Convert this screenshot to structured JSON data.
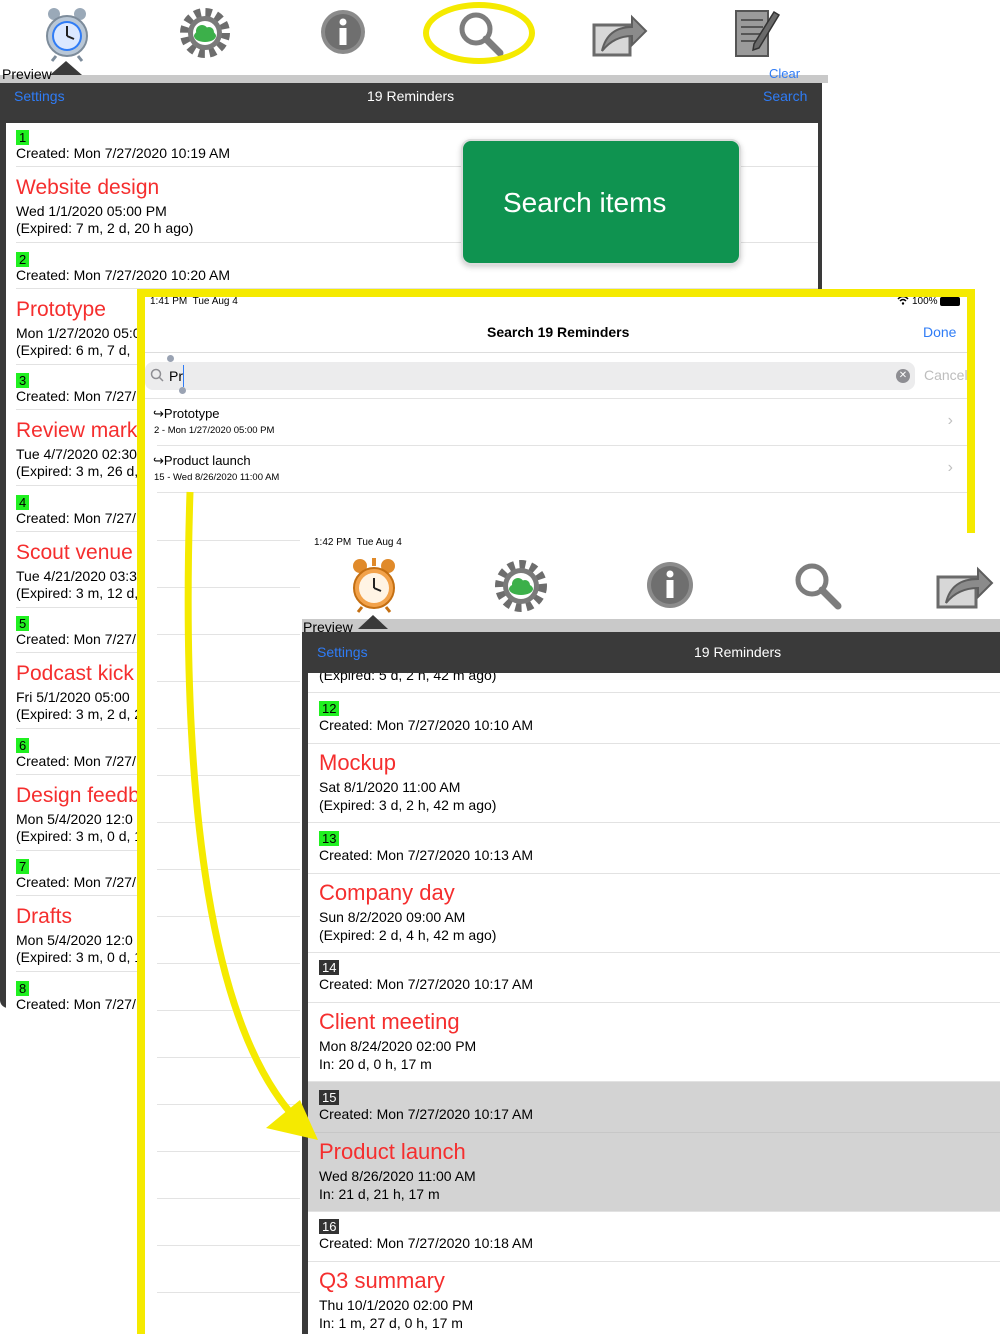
{
  "colors": {
    "accent": "#2f7cf6",
    "title_red": "#f52e2e",
    "badge_green": "#20f020",
    "callout_green": "#0f9350",
    "highlight_yellow": "#f5ea00",
    "navbar_dark": "#3a3a3a"
  },
  "top_icons": [
    "alarm-clock-icon",
    "cloud-gear-icon",
    "info-icon",
    "magnifier-icon",
    "share-export-icon",
    "notepad-icon"
  ],
  "panel1": {
    "tab_label": "Preview",
    "clear_label": "Clear",
    "nav": {
      "settings": "Settings",
      "title": "19 Reminders",
      "search": "Search"
    },
    "items": [
      {
        "num": "1",
        "created": "Created: Mon 7/27/2020 10:19 AM",
        "title": "Website design",
        "date": "Wed 1/1/2020 05:00 PM",
        "status": "(Expired: 7 m, 2 d, 20 h ago)"
      },
      {
        "num": "2",
        "created": "Created: Mon 7/27/2020 10:20 AM",
        "title": "Prototype",
        "date": "Mon 1/27/2020 05:0",
        "status": "(Expired: 6 m, 7 d,"
      },
      {
        "num": "3",
        "created": "Created: Mon 7/27/",
        "title": "Review mark",
        "date": "Tue 4/7/2020 02:30",
        "status": "(Expired: 3 m, 26 d,"
      },
      {
        "num": "4",
        "created": "Created: Mon 7/27/",
        "title": "Scout venue",
        "date": "Tue 4/21/2020 03:3",
        "status": "(Expired: 3 m, 12 d,"
      },
      {
        "num": "5",
        "created": "Created: Mon 7/27/",
        "title": "Podcast kick",
        "date": "Fri 5/1/2020 05:00",
        "status": "(Expired: 3 m, 2 d, 2"
      },
      {
        "num": "6",
        "created": "Created: Mon 7/27/",
        "title": "Design feedb",
        "date": "Mon 5/4/2020 12:0",
        "status": "(Expired: 3 m, 0 d, 1"
      },
      {
        "num": "7",
        "created": "Created: Mon 7/27/",
        "title": "Drafts",
        "date": "Mon 5/4/2020 12:0",
        "status": "(Expired: 3 m, 0 d, 1"
      },
      {
        "num": "8",
        "created": "Created: Mon 7/27/"
      }
    ]
  },
  "callout": {
    "text": "Search items"
  },
  "search_screen": {
    "status": {
      "time": "1:41 PM  Tue Aug 4",
      "battery": "100%"
    },
    "nav": {
      "title": "Search 19 Reminders",
      "done": "Done"
    },
    "query": "Pr",
    "cancel": "Cancel",
    "results": [
      {
        "title": "↪Prototype",
        "sub": "2 - Mon 1/27/2020 05:00 PM"
      },
      {
        "title": "↪Product launch",
        "sub": "15 - Wed 8/26/2020 11:00 AM"
      }
    ]
  },
  "front_screen": {
    "status": {
      "time": "1:42 PM  Tue Aug 4"
    },
    "tab_label": "Preview",
    "nav": {
      "settings": "Settings",
      "title": "19 Reminders"
    },
    "top_cut": "(Expired: 5 d, 2 h, 42 m ago)",
    "items": [
      {
        "num": "12",
        "created": "Created: Mon 7/27/2020 10:10 AM",
        "title": "Mockup",
        "date": "Sat 8/1/2020 11:00 AM",
        "status": "(Expired: 3 d, 2 h, 42 m ago)"
      },
      {
        "num": "13",
        "created": "Created: Mon 7/27/2020 10:13 AM",
        "title": "Company day",
        "date": "Sun 8/2/2020 09:00 AM",
        "status": "(Expired: 2 d, 4 h, 42 m ago)"
      },
      {
        "num": "14",
        "created": "Created: Mon 7/27/2020 10:17 AM",
        "title": "Client meeting",
        "date": "Mon 8/24/2020 02:00 PM",
        "status": "In: 20 d, 0 h, 17 m"
      },
      {
        "num": "15",
        "created": "Created: Mon 7/27/2020 10:17 AM",
        "title": "Product launch",
        "date": "Wed 8/26/2020 11:00 AM",
        "status": "In: 21 d, 21 h, 17 m"
      },
      {
        "num": "16",
        "created": "Created: Mon 7/27/2020 10:18 AM",
        "title": "Q3 summary",
        "date": "Thu 10/1/2020 02:00 PM",
        "status": "In: 1 m, 27 d, 0 h, 17 m"
      }
    ]
  }
}
